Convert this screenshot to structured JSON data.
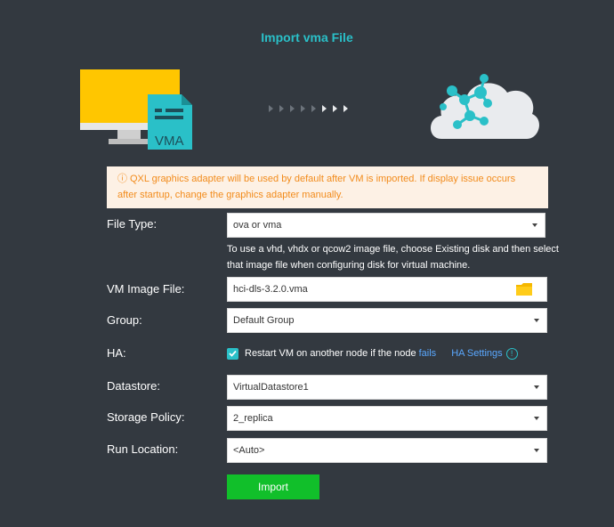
{
  "dialog": {
    "title": "Import vma File"
  },
  "illustration": {
    "file_badge": "VMA",
    "transfer_steps": 8,
    "highlighted_steps": 3
  },
  "notice": {
    "icon": "info-icon",
    "text": "QXL graphics adapter will be used by default after VM is imported. If display issue occurs after startup, change the graphics adapter manually."
  },
  "form": {
    "file_type": {
      "label": "File Type:",
      "value": "ova or vma"
    },
    "hint": "To use a vhd, vhdx or qcow2 image file, choose Existing disk and then select that image file when configuring disk for virtual machine.",
    "vm_image_file": {
      "label": "VM Image File:",
      "value": "hci-dls-3.2.0.vma",
      "icon": "folder-icon"
    },
    "group": {
      "label": "Group:",
      "value": "Default Group"
    },
    "ha": {
      "label": "HA:",
      "checked": true,
      "text": "Restart VM on another node if the node",
      "link": "fails",
      "settings_link": "HA Settings",
      "help_icon": "!"
    },
    "datastore": {
      "label": "Datastore:",
      "value": "VirtualDatastore1"
    },
    "storage_policy": {
      "label": "Storage Policy:",
      "value": "2_replica"
    },
    "run_location": {
      "label": "Run Location:",
      "value": "<Auto>"
    }
  },
  "actions": {
    "import_label": "Import"
  },
  "colors": {
    "background": "#333940",
    "accent": "#2ac0c8",
    "button": "#11bf2a",
    "notice_bg": "#fdf1e5",
    "notice_text": "#f28b1b",
    "link": "#5aa8ff"
  }
}
